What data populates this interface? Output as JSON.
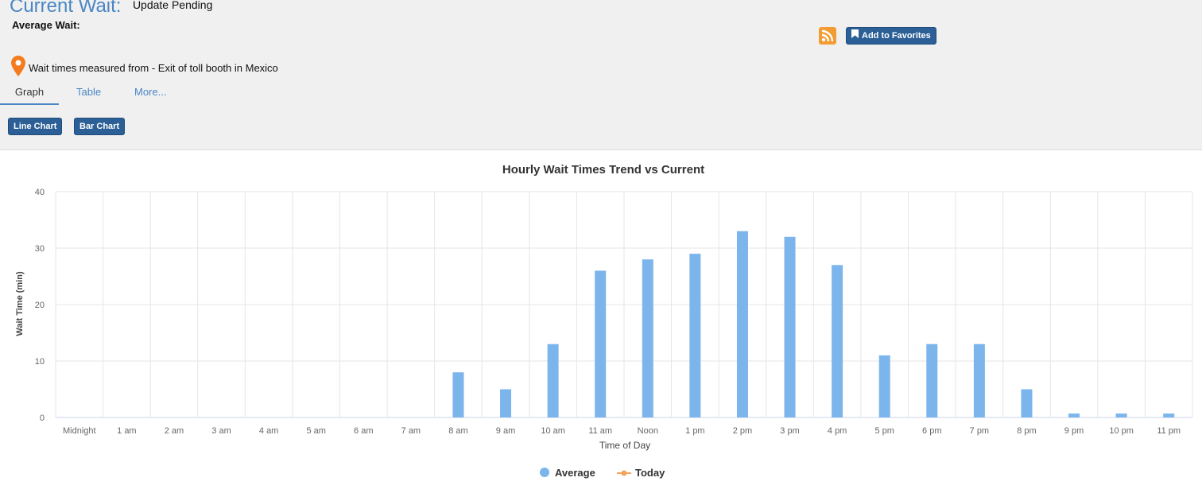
{
  "header": {
    "current_wait_label": "Current Wait:",
    "current_wait_status": "Update Pending",
    "average_wait_label": "Average Wait:",
    "location_text": "Wait times measured from - Exit of toll booth in Mexico"
  },
  "tabs": [
    {
      "label": "Graph"
    },
    {
      "label": "Table"
    },
    {
      "label": "More..."
    }
  ],
  "chart_buttons": {
    "line": "Line Chart",
    "bar": "Bar Chart"
  },
  "favorites_label": "Add to Favorites",
  "icons": {
    "rss": "rss-icon",
    "location": "map-pin-icon",
    "bookmark": "bookmark-icon"
  },
  "colors": {
    "accent": "#4a86c5",
    "button": "#2b5f96",
    "bar": "#7cb5ec",
    "today": "#f7a35c",
    "rss": "#f39c32",
    "pin": "#f47c20"
  },
  "chart_data": {
    "type": "bar",
    "title": "Hourly Wait Times Trend vs Current",
    "xlabel": "Time of Day",
    "ylabel": "Wait Time (min)",
    "ylim": [
      0,
      40
    ],
    "yticks": [
      0,
      10,
      20,
      30,
      40
    ],
    "grid": true,
    "legend_position": "bottom",
    "categories": [
      "Midnight",
      "1 am",
      "2 am",
      "3 am",
      "4 am",
      "5 am",
      "6 am",
      "7 am",
      "8 am",
      "9 am",
      "10 am",
      "11 am",
      "Noon",
      "1 pm",
      "2 pm",
      "3 pm",
      "4 pm",
      "5 pm",
      "6 pm",
      "7 pm",
      "8 pm",
      "9 pm",
      "10 pm",
      "11 pm"
    ],
    "series": [
      {
        "name": "Average",
        "color": "#7cb5ec",
        "values": [
          0,
          0,
          0,
          0,
          0,
          0,
          0,
          0,
          8,
          5,
          13,
          26,
          28,
          29,
          33,
          32,
          27,
          11,
          13,
          13,
          5,
          0.7,
          0.7,
          0.7
        ]
      },
      {
        "name": "Today",
        "color": "#f7a35c",
        "values": []
      }
    ]
  }
}
